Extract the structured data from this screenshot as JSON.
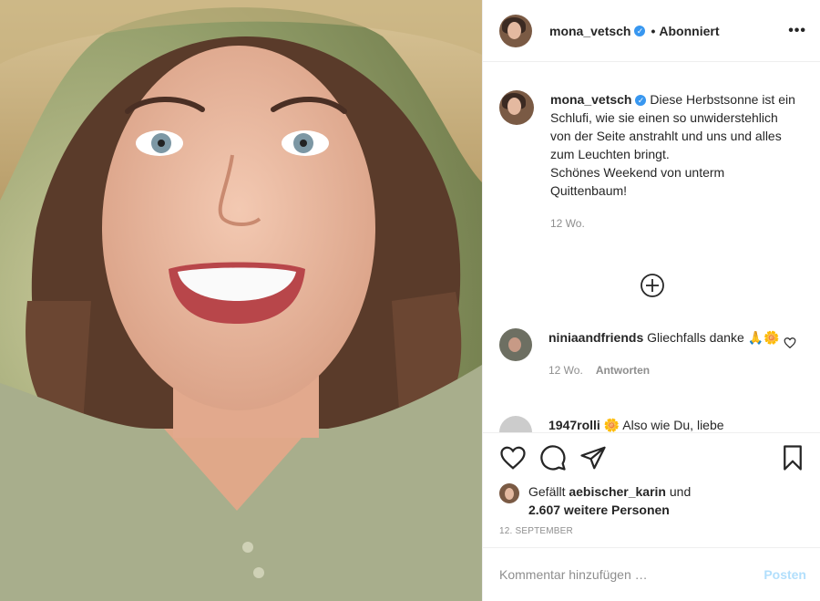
{
  "post": {
    "author": "mona_vetsch",
    "follow_state": "Abonniert",
    "more_icon": "more-horizontal-icon",
    "verified_badge": "verified-badge-icon"
  },
  "caption": {
    "author": "mona_vetsch",
    "text": "Diese Herbstsonne ist ein Schlufi, wie sie einen so unwiderstehlich von der Seite anstrahlt und uns und alles zum Leuchten bringt.\nSchönes Weekend von unterm Quittenbaum!",
    "age": "12 Wo."
  },
  "load_more_icon": "plus-circle-icon",
  "comments": [
    {
      "author": "niniaandfriends",
      "text": "Gliechfalls danke 🙏🌼",
      "age": "12 Wo.",
      "reply_label": "Antworten"
    },
    {
      "author": "1947rolli",
      "text": "🌼 Also wie Du, liebe",
      "age": "",
      "reply_label": ""
    }
  ],
  "actions": {
    "like_icon": "heart-icon",
    "comment_icon": "comment-icon",
    "share_icon": "paper-plane-icon",
    "save_icon": "bookmark-icon"
  },
  "likes": {
    "prefix": "Gefällt ",
    "liked_by": "aebischer_karin",
    "connector": " und",
    "others": "2.607 weitere Personen"
  },
  "date": "12. SEPTEMBER",
  "add_comment": {
    "placeholder": "Kommentar hinzufügen …",
    "post_label": "Posten"
  },
  "colors": {
    "accent": "#3897f0",
    "post_disabled": "#b2dffc",
    "muted_text": "#8e8e8e"
  }
}
